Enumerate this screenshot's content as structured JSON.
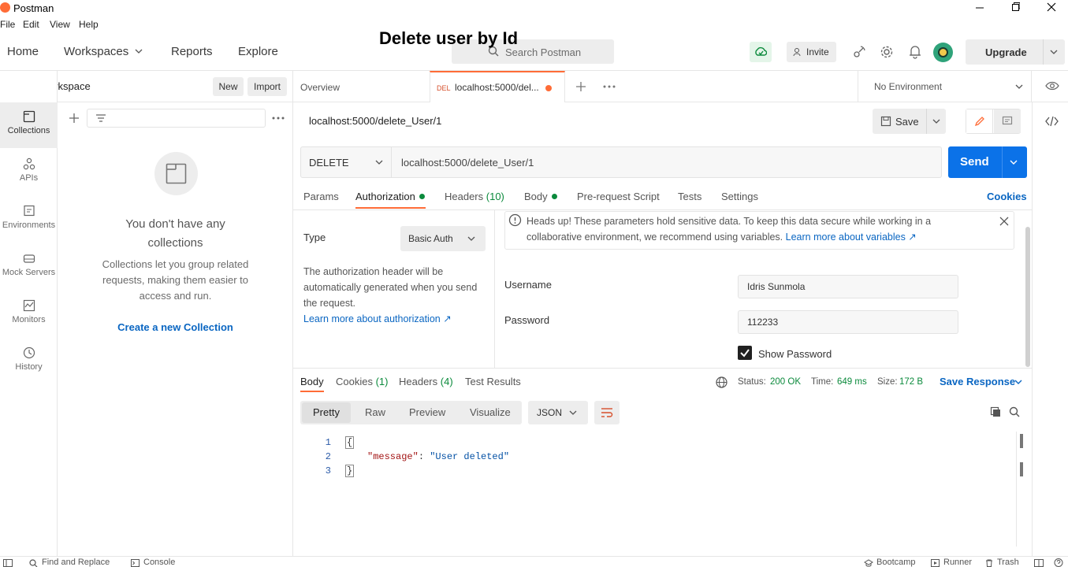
{
  "window": {
    "app_title": "Postman"
  },
  "menu": [
    "File",
    "Edit",
    "View",
    "Help"
  ],
  "nav": {
    "home": "Home",
    "workspaces": "Workspaces",
    "reports": "Reports",
    "explore": "Explore",
    "search_placeholder": "Search Postman",
    "invite": "Invite",
    "upgrade": "Upgrade"
  },
  "overlay_title": "Delete user by Id",
  "workspace": {
    "name": "My Workspace",
    "new": "New",
    "import": "Import"
  },
  "sidebar": {
    "items": [
      {
        "label": "Collections",
        "icon": "collections-icon"
      },
      {
        "label": "APIs",
        "icon": "apis-icon"
      },
      {
        "label": "Environments",
        "icon": "environments-icon"
      },
      {
        "label": "Mock Servers",
        "icon": "mock-servers-icon"
      },
      {
        "label": "Monitors",
        "icon": "monitors-icon"
      },
      {
        "label": "History",
        "icon": "history-icon"
      }
    ]
  },
  "collections": {
    "empty_title_1": "You don't have any",
    "empty_title_2": "collections",
    "empty_desc_1": "Collections let you group related",
    "empty_desc_2": "requests, making them easier to",
    "empty_desc_3": "access and run.",
    "create_link": "Create a new Collection"
  },
  "tabs": {
    "overview": "Overview",
    "active_method": "DEL",
    "active_label": "localhost:5000/del...",
    "environment": "No Environment"
  },
  "request": {
    "title": "localhost:5000/delete_User/1",
    "save": "Save",
    "method": "DELETE",
    "url": "localhost:5000/delete_User/1",
    "send": "Send"
  },
  "req_tabs": {
    "params": "Params",
    "authorization": "Authorization",
    "headers": "Headers",
    "headers_count": "(10)",
    "body": "Body",
    "prerequest": "Pre-request Script",
    "tests": "Tests",
    "settings": "Settings",
    "cookies": "Cookies"
  },
  "auth": {
    "type_label": "Type",
    "type_value": "Basic Auth",
    "desc_1": "The authorization header will be",
    "desc_2": "automatically generated when you send",
    "desc_3": "the request.",
    "learn_more": "Learn more about authorization ↗",
    "banner_1": "Heads up! These parameters hold sensitive data. To keep this data secure while working in a",
    "banner_2": "collaborative environment, we recommend using variables.",
    "banner_link": "Learn more about variables ↗",
    "username_label": "Username",
    "username_value": "Idris Sunmola",
    "password_label": "Password",
    "password_value": "112233",
    "show_password": "Show Password"
  },
  "response": {
    "body": "Body",
    "cookies": "Cookies",
    "cookies_count": "(1)",
    "headers": "Headers",
    "headers_count": "(4)",
    "test_results": "Test Results",
    "status_label": "Status:",
    "status_value": "200 OK",
    "time_label": "Time:",
    "time_value": "649 ms",
    "size_label": "Size:",
    "size_value": "172 B",
    "save_response": "Save Response",
    "views": [
      "Pretty",
      "Raw",
      "Preview",
      "Visualize"
    ],
    "format": "JSON",
    "lines": [
      {
        "num": "1",
        "text": "{"
      },
      {
        "num": "2",
        "key": "\"message\"",
        "colon": ": ",
        "value": "\"User deleted\""
      },
      {
        "num": "3",
        "text": "}"
      }
    ]
  },
  "statusbar": {
    "find_replace": "Find and Replace",
    "console": "Console",
    "bootcamp": "Bootcamp",
    "runner": "Runner",
    "trash": "Trash"
  },
  "colors": {
    "accent_orange": "#ff6c37",
    "send_blue": "#0b72e8",
    "green": "#0b8a3c",
    "link_blue": "#0a66c2"
  }
}
